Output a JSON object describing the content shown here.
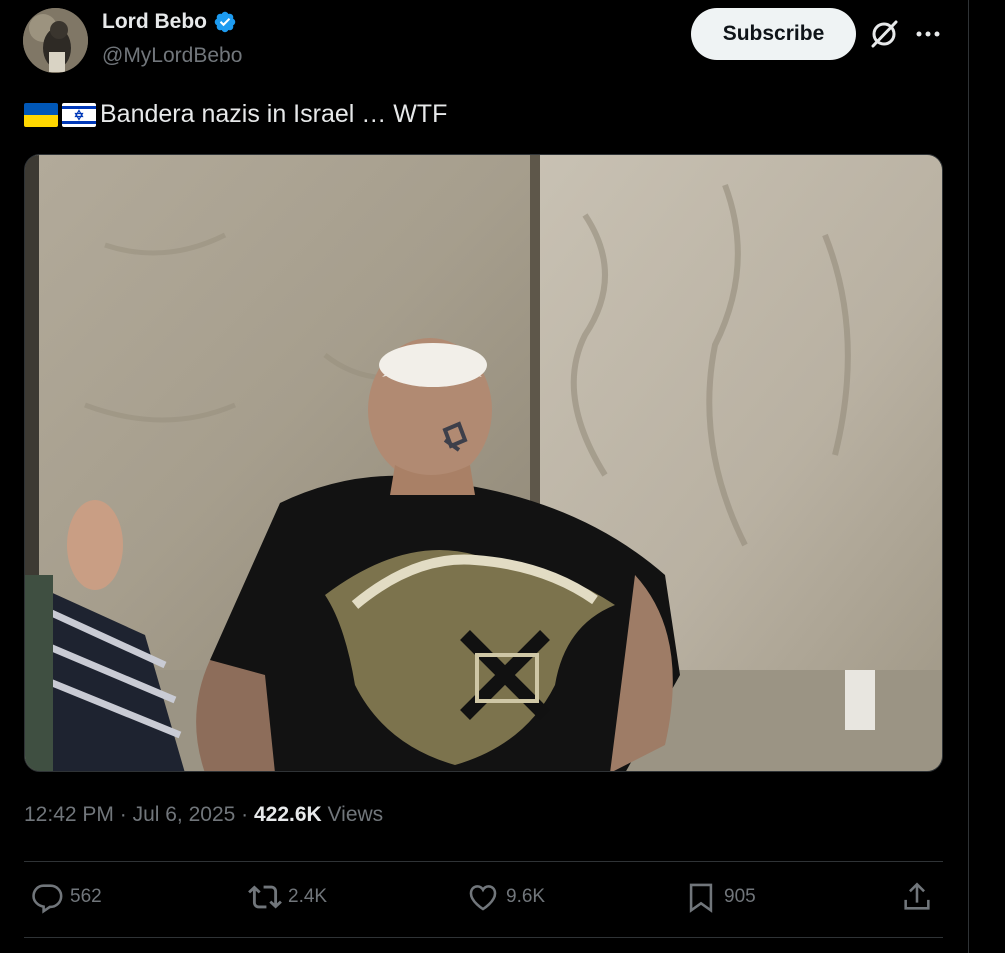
{
  "author": {
    "display_name": "Lord Bebo",
    "handle": "@MyLordBebo",
    "verified_icon": "verified-badge-icon",
    "avatar_icon": "avatar-image"
  },
  "header": {
    "subscribe_label": "Subscribe",
    "grok_icon": "grok-icon",
    "more_icon": "more-horizontal-icon"
  },
  "tweet": {
    "flags": [
      "ukraine-flag-icon",
      "israel-flag-icon"
    ],
    "text": "Bandera nazis in Israel … WTF",
    "media_icon": "photo-man-at-western-wall"
  },
  "meta": {
    "time": "12:42 PM",
    "separator": "·",
    "date": "Jul 6, 2025",
    "views_count": "422.6K",
    "views_label": "Views"
  },
  "actions": {
    "replies": "562",
    "reposts": "2.4K",
    "likes": "9.6K",
    "bookmarks": "905"
  },
  "colors": {
    "background": "#000000",
    "text_primary": "#e7e9ea",
    "text_secondary": "#71767b",
    "verified": "#1d9bf0",
    "divider": "#2f3336"
  }
}
